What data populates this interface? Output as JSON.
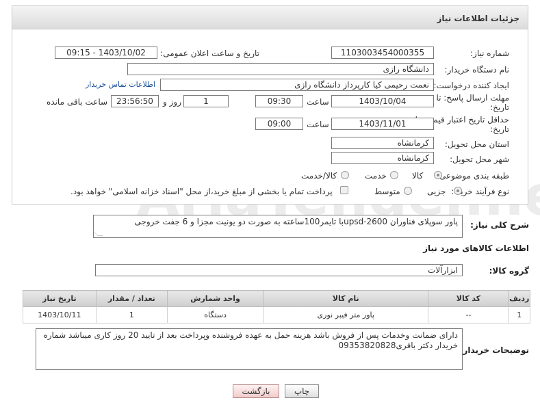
{
  "header": {
    "title": "جزئیات اطلاعات نیاز"
  },
  "form": {
    "need_number": {
      "label": "شماره نیاز:",
      "value": "1103003454000355"
    },
    "announce_date": {
      "label": "تاریخ و ساعت اعلان عمومی:",
      "value": "1403/10/02 - 09:15"
    },
    "buyer_org": {
      "label": "نام دستگاه خریدار:",
      "value": "دانشگاه رازی"
    },
    "creator": {
      "label": "ایجاد کننده درخواست:",
      "value": "نعمت رحیمی کیا کارپرداز دانشگاه رازی",
      "contact_link": "اطلاعات تماس خریدار"
    },
    "response_deadline": {
      "label_line1": "مهلت ارسال پاسخ: تا",
      "label_line2": "تاریخ:",
      "date": "1403/10/04",
      "time_label": "ساعت",
      "time": "09:30",
      "days": "1",
      "days_label": "روز و",
      "remaining": "23:56:50",
      "remaining_label": "ساعت باقی مانده"
    },
    "price_validity": {
      "label_line1": "حداقل تاریخ اعتبار قیمت: تا",
      "label_line2": "تاریخ:",
      "date": "1403/11/01",
      "time_label": "ساعت",
      "time": "09:00"
    },
    "province": {
      "label": "استان محل تحویل:",
      "value": "کرمانشاه"
    },
    "city": {
      "label": "شهر محل تحویل:",
      "value": "کرمانشاه"
    },
    "category": {
      "label": "طبقه بندی موضوعی:",
      "options": [
        "کالا",
        "خدمت",
        "کالا/خدمت"
      ],
      "selected": "کالا"
    },
    "purchase_process": {
      "label": "نوع فرآیند خرید :",
      "options": [
        "جزیی",
        "متوسط"
      ],
      "selected": "جزیی",
      "treasury_note": "پرداخت تمام یا بخشی از مبلغ خرید،از محل \"اسناد خزانه اسلامی\" خواهد بود."
    }
  },
  "description": {
    "label": "شرح کلی نیاز:",
    "value": "پاور سوپلای فناوران upsd-2600با تایمر100ساعته به صورت دو یونیت مجزا و 6 جفت خروجی"
  },
  "goods_info": {
    "title": "اطلاعات کالاهای مورد نیاز",
    "group_label": "گروه کالا:",
    "group_value": "ابزارآلات",
    "columns": [
      "ردیف",
      "کد کالا",
      "نام کالا",
      "واحد شمارش",
      "تعداد / مقدار",
      "تاریخ نیاز"
    ],
    "rows": [
      {
        "row": "1",
        "code": "--",
        "name": "پاور متر فیبر نوری",
        "unit": "دستگاه",
        "qty": "1",
        "date": "1403/10/11"
      }
    ]
  },
  "buyer_notes": {
    "label": "توضیحات خریدار:",
    "value": "دارای ضمانت وخدمات پس از فروش باشد هزینه حمل به عهده فروشنده وپرداخت بعد از تایید 20 روز کاری میباشد شماره خریدار دکتر باقری09353820828"
  },
  "buttons": {
    "print": "چاپ",
    "back": "بازگشت"
  },
  "watermark": "AriaTender.neT"
}
